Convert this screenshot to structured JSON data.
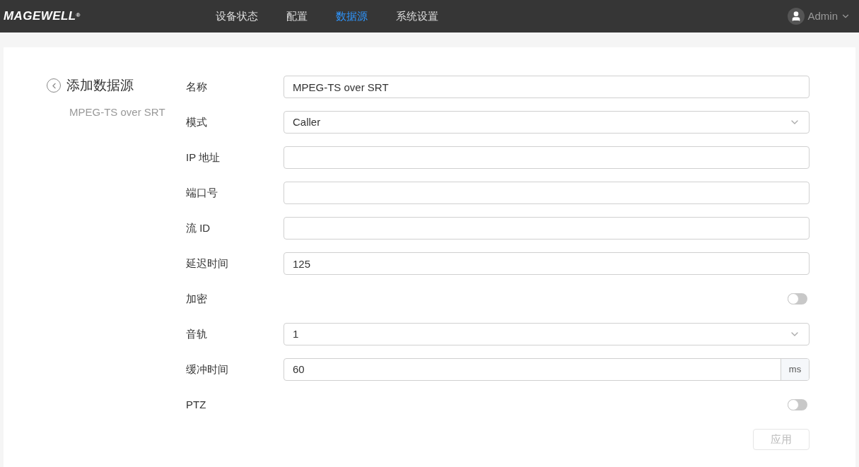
{
  "header": {
    "logo": "MAGEWELL",
    "logo_mark": "®",
    "nav": [
      {
        "label": "设备状态",
        "selected": false
      },
      {
        "label": "配置",
        "selected": false
      },
      {
        "label": "数据源",
        "selected": true
      },
      {
        "label": "系统设置",
        "selected": false
      }
    ],
    "user": "Admin"
  },
  "sidebar": {
    "title": "添加数据源",
    "subtitle": "MPEG-TS over SRT"
  },
  "form": [
    {
      "kind": "text",
      "label": "名称",
      "value": "MPEG-TS over SRT"
    },
    {
      "kind": "select",
      "label": "模式",
      "value": "Caller"
    },
    {
      "kind": "text",
      "label": "IP 地址"
    },
    {
      "kind": "text",
      "label": "端口号"
    },
    {
      "kind": "text",
      "label": "流 ID"
    },
    {
      "kind": "text",
      "label": "延迟时间",
      "value": "125"
    },
    {
      "kind": "toggle",
      "label": "加密",
      "on": false
    },
    {
      "kind": "select",
      "label": "音轨",
      "value": "1"
    },
    {
      "kind": "unit",
      "label": "缓冲时间",
      "value": "60",
      "unit": "ms"
    },
    {
      "kind": "toggle",
      "label": "PTZ",
      "on": false
    }
  ],
  "apply_button": {
    "label": "应用",
    "disabled": true
  }
}
